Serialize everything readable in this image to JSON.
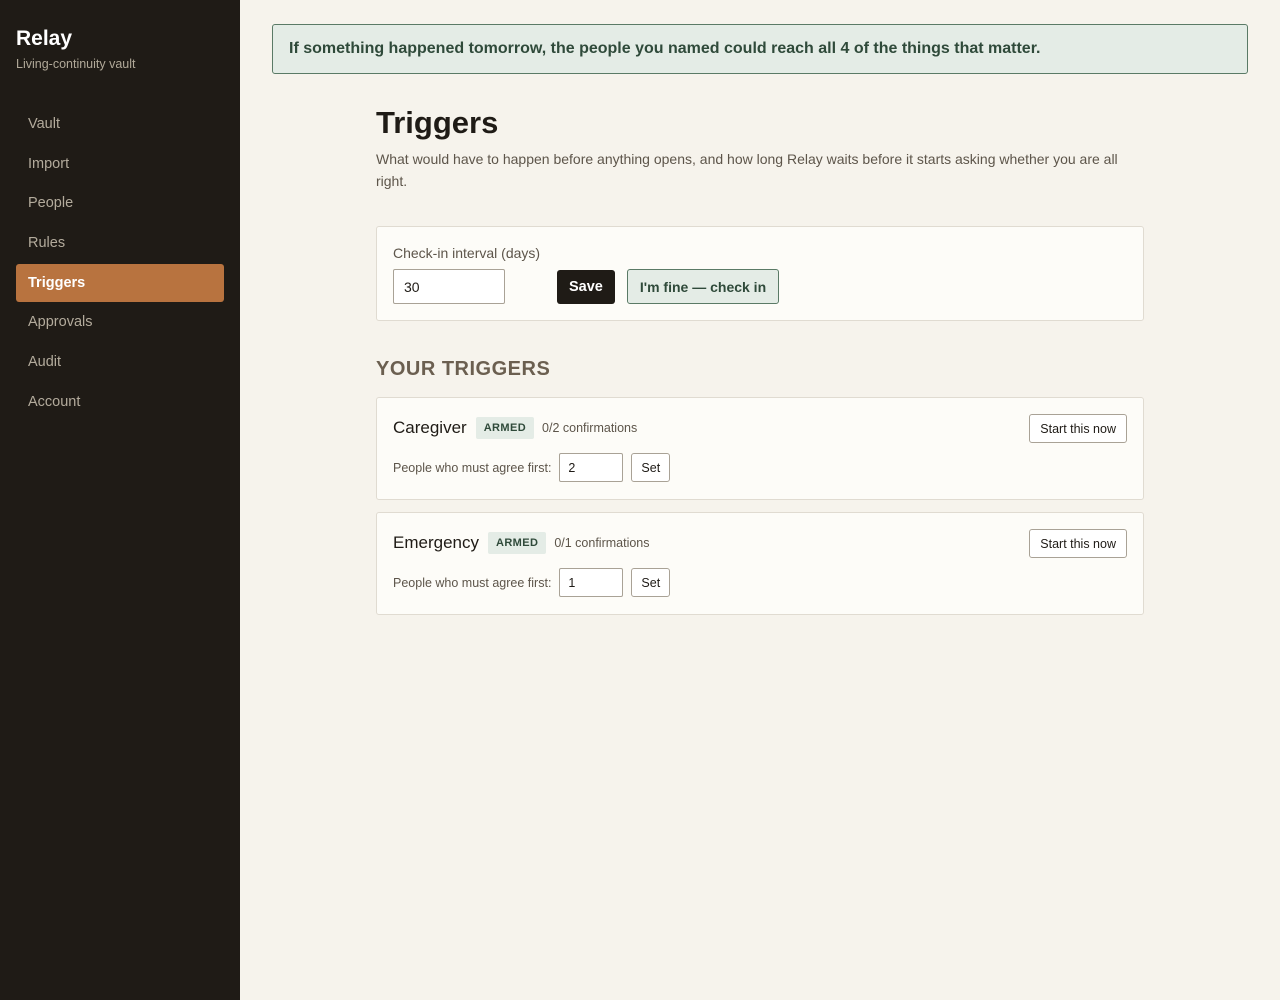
{
  "sidebar": {
    "brand": "Relay",
    "tagline": "Living-continuity vault",
    "items": [
      {
        "label": "Vault",
        "active": false
      },
      {
        "label": "Import",
        "active": false
      },
      {
        "label": "People",
        "active": false
      },
      {
        "label": "Rules",
        "active": false
      },
      {
        "label": "Triggers",
        "active": true
      },
      {
        "label": "Approvals",
        "active": false
      },
      {
        "label": "Audit",
        "active": false
      },
      {
        "label": "Account",
        "active": false
      }
    ]
  },
  "banner": {
    "text": "If something happened tomorrow, the people you named could reach all 4 of the things that matter."
  },
  "page": {
    "title": "Triggers",
    "description": "What would have to happen before anything opens, and how long Relay waits before it starts asking whether you are all right."
  },
  "interval": {
    "label": "Check-in interval (days)",
    "value": "30",
    "save_label": "Save",
    "checkin_label": "I'm fine — check in"
  },
  "triggers": {
    "heading": "YOUR TRIGGERS",
    "items": [
      {
        "name": "Caregiver",
        "status": "ARMED",
        "confirmations": "0/2 confirmations",
        "start_label": "Start this now",
        "agree_label": "People who must agree first:",
        "agree_value": "2",
        "set_label": "Set"
      },
      {
        "name": "Emergency",
        "status": "ARMED",
        "confirmations": "0/1 confirmations",
        "start_label": "Start this now",
        "agree_label": "People who must agree first:",
        "agree_value": "1",
        "set_label": "Set"
      }
    ]
  },
  "colors": {
    "sidebar_bg": "#1f1b16",
    "accent": "#b8733f",
    "success_bg": "#e4ece6",
    "success_text": "#2f4a3a",
    "page_bg": "#f6f3ec"
  }
}
